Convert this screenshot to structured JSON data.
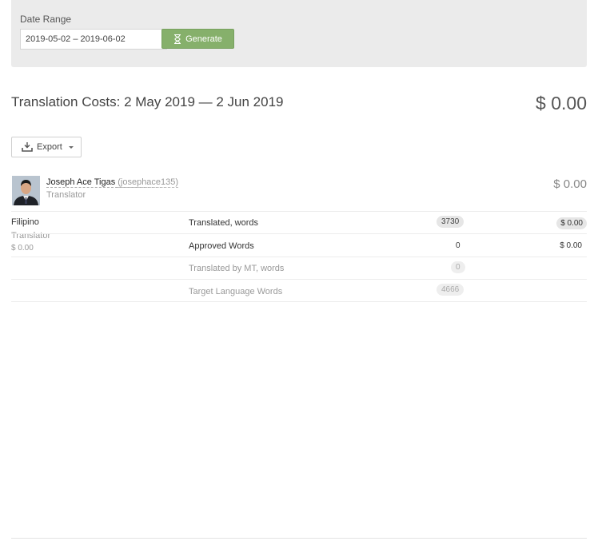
{
  "filter": {
    "label": "Date Range",
    "date_value": "2019-05-02 – 2019-06-02",
    "generate_label": "Generate"
  },
  "report": {
    "title": "Translation Costs: 2 May 2019 — 2 Jun 2019",
    "total": "$ 0.00",
    "export_label": "Export"
  },
  "user": {
    "name": "Joseph Ace Tigas",
    "handle": "(josephace135)",
    "role": "Translator",
    "total": "$ 0.00"
  },
  "language": {
    "name": "Filipino",
    "role": "Translator",
    "cost": "$ 0.00"
  },
  "metrics": [
    {
      "label": "Translated, words",
      "value": "3730",
      "cost": "$ 0.00"
    },
    {
      "label": "Approved Words",
      "value": "0",
      "cost": "$ 0.00"
    },
    {
      "label": "Translated by MT, words",
      "value": "0",
      "cost": ""
    },
    {
      "label": "Target Language Words",
      "value": "4666",
      "cost": ""
    }
  ],
  "colors": {
    "generate_button": "#86b06b",
    "panel_background": "#ebebeb"
  }
}
